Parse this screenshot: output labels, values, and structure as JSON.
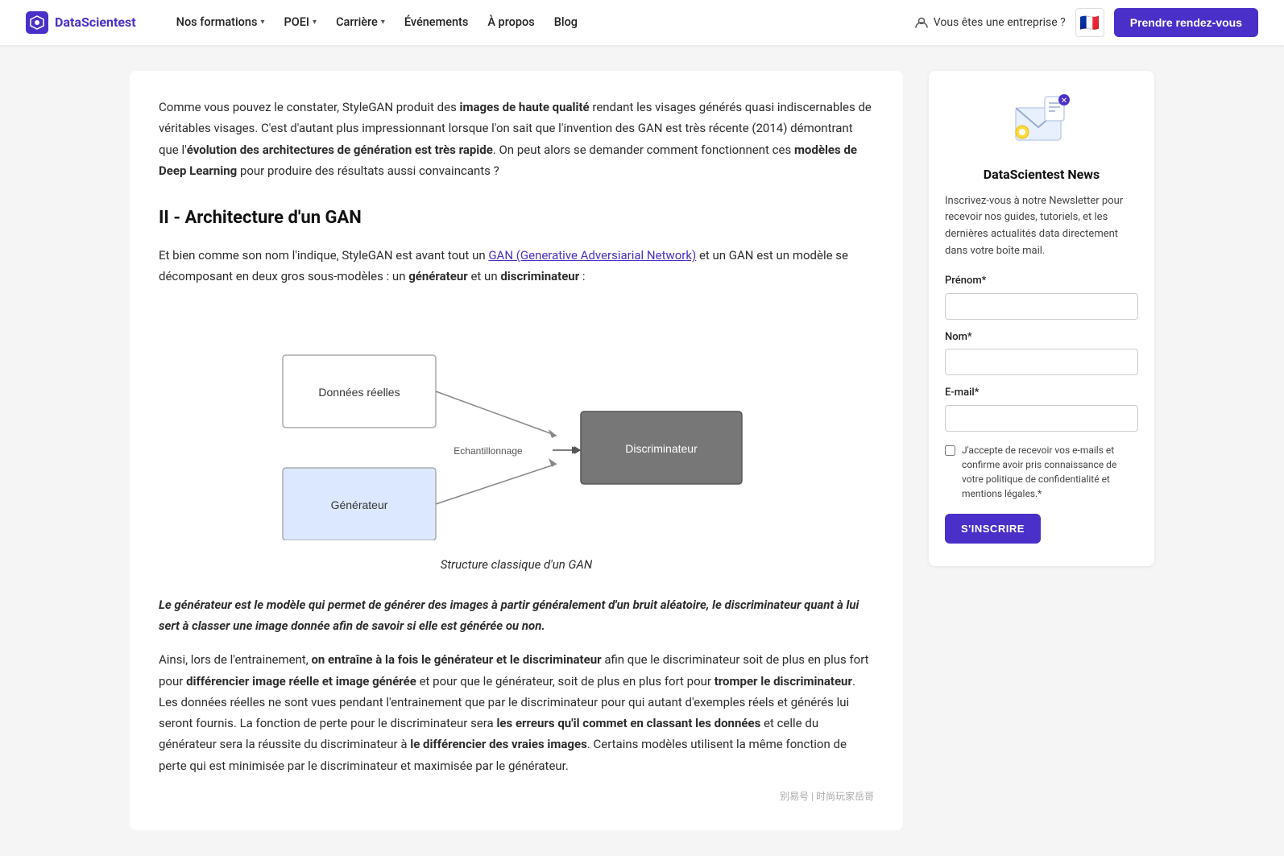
{
  "navbar": {
    "logo_text": "DataScientest",
    "nav_items": [
      {
        "label": "Nos formations",
        "has_dropdown": true
      },
      {
        "label": "POEI",
        "has_dropdown": true
      },
      {
        "label": "Carrière",
        "has_dropdown": true
      },
      {
        "label": "Événements",
        "has_dropdown": false
      },
      {
        "label": "À propos",
        "has_dropdown": false
      },
      {
        "label": "Blog",
        "has_dropdown": false
      }
    ],
    "enterprise_text": "Vous êtes une entreprise ?",
    "flag_emoji": "🇫🇷",
    "cta_label": "Prendre rendez-vous"
  },
  "article": {
    "intro_para1_start": "Comme vous pouvez le constater, StyleGAN produit des ",
    "intro_bold1": "images de haute qualité",
    "intro_para1_mid": " rendant les visages générés quasi indiscernables de véritables visages. C'est d'autant plus impressionnant lorsque l'on sait que l'invention des GAN est très récente (2014) démontrant que l'",
    "intro_bold2": "évolution des architectures de génération est très rapide",
    "intro_para1_end": ". On peut alors se demander comment fonctionnent ces ",
    "intro_bold3": "modèles de Deep Learning",
    "intro_para1_close": " pour produire des résultats aussi convaincants ?",
    "section_title": "II - Architecture d'un GAN",
    "section_para1_start": "Et bien comme son nom l'indique, StyleGAN est avant tout un ",
    "section_link": "GAN (Generative Adversiarial Network)",
    "section_para1_end": " et un GAN est un modèle se décomposant en deux gros sous-modèles : un ",
    "section_bold1": "générateur",
    "section_para1_mid": " et un ",
    "section_bold2": "discriminateur",
    "section_para1_close": " :",
    "diagram_caption": "Structure classique d'un GAN",
    "diagram_label_donnees": "Données réelles",
    "diagram_label_echantillonnage": "Echantillonnage",
    "diagram_label_discriminateur": "Discriminateur",
    "diagram_label_generateur": "Générateur",
    "blockquote": "Le générateur est le modèle qui permet de générer des images à partir généralement d'un bruit aléatoire, le discriminateur quant à lui sert à classer une image donnée afin de savoir si elle est générée ou non.",
    "para2_start": "Ainsi, lors de l'entrainement, ",
    "para2_bold1": "on entraîne à la fois le générateur et le discriminateur",
    "para2_mid": " afin que le discriminateur soit de plus en plus fort pour ",
    "para2_bold2": "différencier image réelle et image générée",
    "para2_mid2": " et pour que le générateur, soit de plus en plus fort pour ",
    "para2_bold3": "tromper le discriminateur",
    "para2_end": ". Les données réelles ne sont vues pendant l'entrainement que par le discriminateur pour qui autant d'exemples réels et générés lui seront fournis. La fonction de perte pour le discriminateur sera ",
    "para2_bold4": "les erreurs qu'il commet en classant les données",
    "para2_mid3": " et celle du générateur sera la réussite du discriminateur à ",
    "para2_bold5": "le différencier des vraies images",
    "para2_end2": ". Certains modèles utilisent la même fonction de perte qui est minimisée par le discriminateur et maximisée par le générateur."
  },
  "newsletter": {
    "title": "DataScientest News",
    "description": "Inscrivez-vous à notre Newsletter pour recevoir nos guides, tutoriels, et les dernières actualités data directement dans votre boîte mail.",
    "prenom_label": "Prénom*",
    "prenom_placeholder": "",
    "nom_label": "Nom*",
    "nom_placeholder": "",
    "email_label": "E-mail*",
    "email_placeholder": "",
    "checkbox_text": "J'accepte de recevoir vos e-mails et confirme avoir pris connaissance de votre politique de confidentialité et mentions légales.*",
    "subscribe_btn": "S'INSCRIRE"
  }
}
